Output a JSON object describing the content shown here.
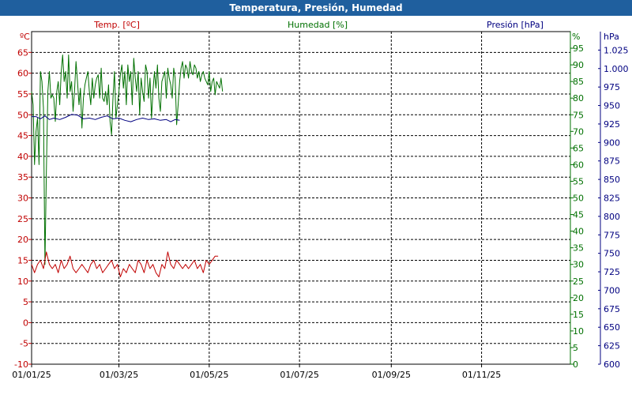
{
  "window": {
    "title": "Temperatura, Presión, Humedad"
  },
  "chart_data": {
    "type": "line",
    "colors": {
      "temperature": "#c00000",
      "humidity": "#007000",
      "pressure": "#000080",
      "grid": "#000000"
    },
    "x_ticks": [
      "01/01/25",
      "01/03/25",
      "01/05/25",
      "01/07/25",
      "01/09/25",
      "01/11/25"
    ],
    "x_tick_dates": [
      "2025-01-01",
      "2025-03-01",
      "2025-05-01",
      "2025-07-01",
      "2025-09-01",
      "2025-11-01"
    ],
    "xlim": [
      "2025-01-01",
      "2025-12-31"
    ],
    "axes": {
      "temperature": {
        "label": "Temp. [ºC]",
        "unit": "ºC",
        "ylim": [
          -10,
          70
        ],
        "ticks": [
          "65",
          "60",
          "55",
          "50",
          "45",
          "40",
          "35",
          "30",
          "25",
          "20",
          "15",
          "10",
          "5",
          "0",
          "-5",
          "-10"
        ]
      },
      "humidity": {
        "label": "Humedad [%]",
        "unit": "%",
        "ylim": [
          0,
          100
        ],
        "ticks": [
          "95",
          "90",
          "85",
          "80",
          "75",
          "70",
          "65",
          "60",
          "55",
          "50",
          "45",
          "40",
          "35",
          "30",
          "25",
          "20",
          "15",
          "10",
          "5",
          "0"
        ]
      },
      "pressure": {
        "label": "Presión [hPa]",
        "unit": "hPa",
        "ylim": [
          600,
          1050
        ],
        "ticks": [
          "1.025",
          "1.000",
          "975",
          "950",
          "925",
          "900",
          "875",
          "850",
          "825",
          "800",
          "775",
          "750",
          "725",
          "700",
          "675",
          "650",
          "625",
          "600"
        ]
      }
    },
    "series": [
      {
        "key": "humidity",
        "axis": "humidity",
        "values": [
          [
            "2025-01-01",
            82
          ],
          [
            "2025-01-02",
            78
          ],
          [
            "2025-01-03",
            60
          ],
          [
            "2025-01-04",
            70
          ],
          [
            "2025-01-05",
            74
          ],
          [
            "2025-01-06",
            60
          ],
          [
            "2025-01-07",
            88
          ],
          [
            "2025-01-08",
            85
          ],
          [
            "2025-01-09",
            77
          ],
          [
            "2025-01-10",
            30
          ],
          [
            "2025-01-11",
            58
          ],
          [
            "2025-01-12",
            82
          ],
          [
            "2025-01-13",
            88
          ],
          [
            "2025-01-14",
            80
          ],
          [
            "2025-01-15",
            81
          ],
          [
            "2025-01-16",
            80
          ],
          [
            "2025-01-17",
            73
          ],
          [
            "2025-01-18",
            82
          ],
          [
            "2025-01-19",
            85
          ],
          [
            "2025-01-20",
            78
          ],
          [
            "2025-01-21",
            88
          ],
          [
            "2025-01-22",
            93
          ],
          [
            "2025-01-23",
            85
          ],
          [
            "2025-01-24",
            88
          ],
          [
            "2025-01-25",
            80
          ],
          [
            "2025-01-26",
            93
          ],
          [
            "2025-01-27",
            82
          ],
          [
            "2025-01-28",
            85
          ],
          [
            "2025-01-29",
            76
          ],
          [
            "2025-01-30",
            82
          ],
          [
            "2025-01-31",
            91
          ],
          [
            "2025-02-01",
            85
          ],
          [
            "2025-02-02",
            78
          ],
          [
            "2025-02-03",
            83
          ],
          [
            "2025-02-04",
            71
          ],
          [
            "2025-02-05",
            80
          ],
          [
            "2025-02-06",
            84
          ],
          [
            "2025-02-07",
            86
          ],
          [
            "2025-02-08",
            88
          ],
          [
            "2025-02-09",
            82
          ],
          [
            "2025-02-10",
            78
          ],
          [
            "2025-02-11",
            86
          ],
          [
            "2025-02-12",
            80
          ],
          [
            "2025-02-13",
            84
          ],
          [
            "2025-02-14",
            86
          ],
          [
            "2025-02-15",
            87
          ],
          [
            "2025-02-16",
            80
          ],
          [
            "2025-02-17",
            89
          ],
          [
            "2025-02-18",
            80
          ],
          [
            "2025-02-19",
            79
          ],
          [
            "2025-02-20",
            82
          ],
          [
            "2025-02-21",
            78
          ],
          [
            "2025-02-22",
            84
          ],
          [
            "2025-02-23",
            73
          ],
          [
            "2025-02-24",
            69
          ],
          [
            "2025-02-25",
            80
          ],
          [
            "2025-02-26",
            88
          ],
          [
            "2025-02-27",
            74
          ],
          [
            "2025-03-01",
            82
          ],
          [
            "2025-03-02",
            87
          ],
          [
            "2025-03-03",
            90
          ],
          [
            "2025-03-04",
            83
          ],
          [
            "2025-03-05",
            88
          ],
          [
            "2025-03-06",
            78
          ],
          [
            "2025-03-07",
            90
          ],
          [
            "2025-03-08",
            85
          ],
          [
            "2025-03-09",
            88
          ],
          [
            "2025-03-10",
            78
          ],
          [
            "2025-03-11",
            92
          ],
          [
            "2025-03-12",
            86
          ],
          [
            "2025-03-13",
            82
          ],
          [
            "2025-03-14",
            88
          ],
          [
            "2025-03-15",
            75
          ],
          [
            "2025-03-16",
            86
          ],
          [
            "2025-03-17",
            82
          ],
          [
            "2025-03-18",
            79
          ],
          [
            "2025-03-19",
            90
          ],
          [
            "2025-03-20",
            88
          ],
          [
            "2025-03-21",
            80
          ],
          [
            "2025-03-22",
            86
          ],
          [
            "2025-03-23",
            74
          ],
          [
            "2025-03-24",
            82
          ],
          [
            "2025-03-25",
            88
          ],
          [
            "2025-03-26",
            83
          ],
          [
            "2025-03-27",
            90
          ],
          [
            "2025-03-28",
            80
          ],
          [
            "2025-03-29",
            76
          ],
          [
            "2025-03-30",
            85
          ],
          [
            "2025-04-01",
            88
          ],
          [
            "2025-04-02",
            80
          ],
          [
            "2025-04-03",
            89
          ],
          [
            "2025-04-04",
            86
          ],
          [
            "2025-04-05",
            84
          ],
          [
            "2025-04-06",
            80
          ],
          [
            "2025-04-07",
            89
          ],
          [
            "2025-04-08",
            86
          ],
          [
            "2025-04-09",
            72
          ],
          [
            "2025-04-10",
            78
          ],
          [
            "2025-04-11",
            85
          ],
          [
            "2025-04-12",
            89
          ],
          [
            "2025-04-13",
            91
          ],
          [
            "2025-04-14",
            86
          ],
          [
            "2025-04-15",
            90
          ],
          [
            "2025-04-16",
            89
          ],
          [
            "2025-04-17",
            86
          ],
          [
            "2025-04-18",
            91
          ],
          [
            "2025-04-19",
            88
          ],
          [
            "2025-04-20",
            87
          ],
          [
            "2025-04-21",
            90
          ],
          [
            "2025-04-22",
            89
          ],
          [
            "2025-04-23",
            86
          ],
          [
            "2025-04-24",
            88
          ],
          [
            "2025-04-25",
            85
          ],
          [
            "2025-04-26",
            87
          ],
          [
            "2025-04-27",
            88
          ],
          [
            "2025-04-28",
            86
          ],
          [
            "2025-04-29",
            85
          ],
          [
            "2025-04-30",
            84
          ],
          [
            "2025-05-01",
            88
          ],
          [
            "2025-05-02",
            82
          ],
          [
            "2025-05-03",
            85
          ],
          [
            "2025-05-04",
            86
          ],
          [
            "2025-05-05",
            81
          ],
          [
            "2025-05-06",
            85
          ],
          [
            "2025-05-07",
            84
          ],
          [
            "2025-05-08",
            83
          ],
          [
            "2025-05-09",
            86
          ],
          [
            "2025-05-10",
            82
          ]
        ]
      },
      {
        "key": "pressure",
        "axis": "pressure",
        "values": [
          [
            "2025-01-01",
            935
          ],
          [
            "2025-01-04",
            935
          ],
          [
            "2025-01-07",
            932
          ],
          [
            "2025-01-10",
            936
          ],
          [
            "2025-01-13",
            931
          ],
          [
            "2025-01-16",
            933
          ],
          [
            "2025-01-20",
            931
          ],
          [
            "2025-01-24",
            934
          ],
          [
            "2025-01-28",
            938
          ],
          [
            "2025-02-01",
            937
          ],
          [
            "2025-02-05",
            932
          ],
          [
            "2025-02-09",
            933
          ],
          [
            "2025-02-13",
            931
          ],
          [
            "2025-02-17",
            934
          ],
          [
            "2025-02-21",
            936
          ],
          [
            "2025-02-25",
            932
          ],
          [
            "2025-03-01",
            933
          ],
          [
            "2025-03-05",
            930
          ],
          [
            "2025-03-09",
            928
          ],
          [
            "2025-03-13",
            931
          ],
          [
            "2025-03-17",
            933
          ],
          [
            "2025-03-21",
            931
          ],
          [
            "2025-03-25",
            932
          ],
          [
            "2025-03-29",
            930
          ],
          [
            "2025-04-02",
            931
          ],
          [
            "2025-04-05",
            928
          ],
          [
            "2025-04-08",
            931
          ],
          [
            "2025-04-11",
            930
          ]
        ]
      },
      {
        "key": "temperature",
        "axis": "temperature",
        "values": [
          [
            "2025-01-01",
            14
          ],
          [
            "2025-01-03",
            12
          ],
          [
            "2025-01-05",
            14
          ],
          [
            "2025-01-07",
            15
          ],
          [
            "2025-01-09",
            13
          ],
          [
            "2025-01-11",
            17
          ],
          [
            "2025-01-13",
            14
          ],
          [
            "2025-01-15",
            13
          ],
          [
            "2025-01-17",
            14
          ],
          [
            "2025-01-19",
            12
          ],
          [
            "2025-01-21",
            15
          ],
          [
            "2025-01-23",
            13
          ],
          [
            "2025-01-25",
            14
          ],
          [
            "2025-01-27",
            16
          ],
          [
            "2025-01-29",
            13
          ],
          [
            "2025-01-31",
            12
          ],
          [
            "2025-02-02",
            13
          ],
          [
            "2025-02-04",
            14
          ],
          [
            "2025-02-06",
            13
          ],
          [
            "2025-02-08",
            12
          ],
          [
            "2025-02-10",
            14
          ],
          [
            "2025-02-12",
            15
          ],
          [
            "2025-02-14",
            13
          ],
          [
            "2025-02-16",
            14
          ],
          [
            "2025-02-18",
            12
          ],
          [
            "2025-02-20",
            13
          ],
          [
            "2025-02-22",
            14
          ],
          [
            "2025-02-24",
            15
          ],
          [
            "2025-02-26",
            13
          ],
          [
            "2025-02-28",
            14
          ],
          [
            "2025-03-02",
            11
          ],
          [
            "2025-03-04",
            13
          ],
          [
            "2025-03-06",
            12
          ],
          [
            "2025-03-08",
            14
          ],
          [
            "2025-03-10",
            13
          ],
          [
            "2025-03-12",
            12
          ],
          [
            "2025-03-14",
            15
          ],
          [
            "2025-03-16",
            14
          ],
          [
            "2025-03-18",
            12
          ],
          [
            "2025-03-20",
            15
          ],
          [
            "2025-03-22",
            13
          ],
          [
            "2025-03-24",
            14
          ],
          [
            "2025-03-26",
            12
          ],
          [
            "2025-03-28",
            11
          ],
          [
            "2025-03-30",
            14
          ],
          [
            "2025-04-01",
            13
          ],
          [
            "2025-04-03",
            17
          ],
          [
            "2025-04-05",
            14
          ],
          [
            "2025-04-07",
            13
          ],
          [
            "2025-04-09",
            15
          ],
          [
            "2025-04-11",
            14
          ],
          [
            "2025-04-13",
            13
          ],
          [
            "2025-04-15",
            14
          ],
          [
            "2025-04-17",
            13
          ],
          [
            "2025-04-19",
            14
          ],
          [
            "2025-04-21",
            15
          ],
          [
            "2025-04-23",
            13
          ],
          [
            "2025-04-25",
            14
          ],
          [
            "2025-04-27",
            12
          ],
          [
            "2025-04-29",
            15
          ],
          [
            "2025-05-01",
            14
          ],
          [
            "2025-05-03",
            15
          ],
          [
            "2025-05-05",
            16
          ],
          [
            "2025-05-07",
            16
          ]
        ]
      }
    ]
  }
}
